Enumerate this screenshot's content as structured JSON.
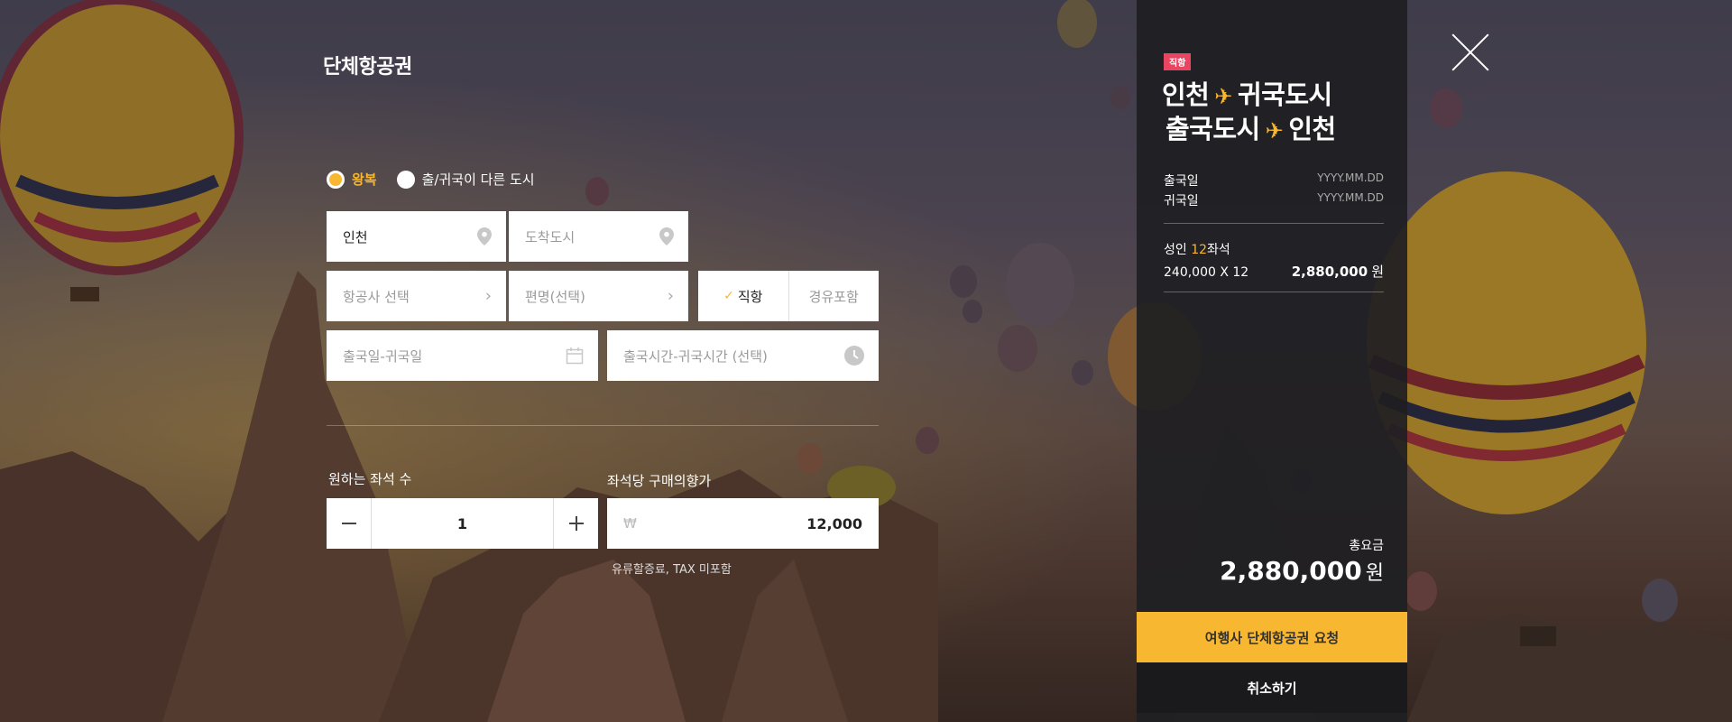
{
  "page_title": "단체항공권",
  "trip_type": {
    "options": [
      {
        "label": "왕복",
        "selected": true
      },
      {
        "label": "출/귀국이 다른 도시",
        "selected": false
      }
    ]
  },
  "form": {
    "departure_city": "인천",
    "arrival_city_placeholder": "도착도시",
    "airline_placeholder": "항공사 선택",
    "flight_placeholder": "편명(선택)",
    "direct_label": "직항",
    "connecting_label": "경유포함",
    "dates_placeholder": "출국일-귀국일",
    "times_placeholder": "출국시간-귀국시간 (선택)",
    "seats_label": "원하는 좌석 수",
    "seats_value": "1",
    "price_label": "좌석당 구매의향가",
    "currency_symbol": "₩",
    "price_value": "12,000",
    "price_note": "유류할증료, TAX 미포함"
  },
  "summary": {
    "tag": "직항",
    "route_line1_from": "인천",
    "route_line1_to": "귀국도시",
    "route_line2_from": "출국도시",
    "route_line2_to": "인천",
    "departure_label": "출국일",
    "departure_value": "YYYY.MM.DD",
    "return_label": "귀국일",
    "return_value": "YYYY.MM.DD",
    "seat_prefix": "성인 ",
    "seat_count": "12",
    "seat_suffix": "좌석",
    "unit_calc": "240,000 X 12",
    "subtotal": "2,880,000",
    "won": "원",
    "total_label": "총요금",
    "total_amount": "2,880,000",
    "request_button": "여행사 단체항공권 요청",
    "cancel_button": "취소하기"
  },
  "colors": {
    "accent": "#f7b731",
    "tag": "#e94561",
    "panel": "#1e1e22"
  }
}
